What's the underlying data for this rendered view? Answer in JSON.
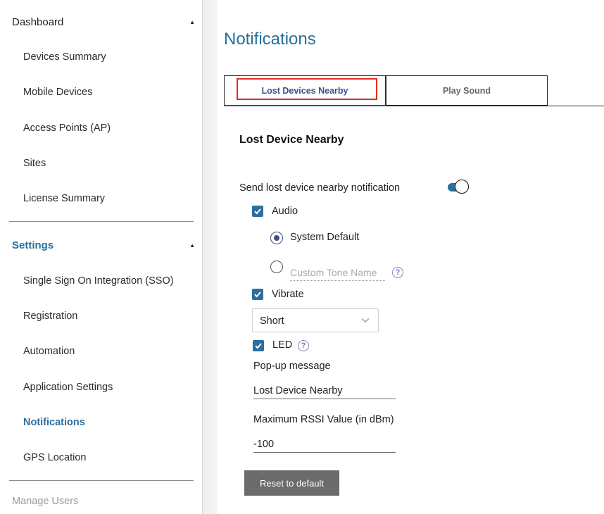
{
  "sidebar": {
    "dashboard": {
      "label": "Dashboard",
      "items": [
        "Devices Summary",
        "Mobile Devices",
        "Access Points (AP)",
        "Sites",
        "License Summary"
      ]
    },
    "settings": {
      "label": "Settings",
      "items": [
        "Single Sign On Integration (SSO)",
        "Registration",
        "Automation",
        "Application Settings",
        "Notifications",
        "GPS Location"
      ],
      "active_item": "Notifications"
    },
    "manage_users": "Manage Users"
  },
  "page": {
    "title": "Notifications"
  },
  "tabs": [
    {
      "label": "Lost Devices Nearby",
      "active": true
    },
    {
      "label": "Play Sound",
      "active": false
    }
  ],
  "form": {
    "section_title": "Lost Device Nearby",
    "send_notification": {
      "label": "Send lost device nearby notification",
      "on": true
    },
    "audio": {
      "label": "Audio",
      "checked": true,
      "options": [
        "System Default"
      ],
      "selected": "System Default",
      "custom_tone_placeholder": "Custom Tone Name"
    },
    "vibrate": {
      "label": "Vibrate",
      "checked": true,
      "selected": "Short"
    },
    "led": {
      "label": "LED",
      "checked": true
    },
    "popup": {
      "label": "Pop-up message",
      "value": "Lost Device Nearby"
    },
    "rssi": {
      "label": "Maximum RSSI Value (in dBm)",
      "value": "-100"
    },
    "reset_label": "Reset to default"
  },
  "colors": {
    "accent": "#2a6f9e",
    "active_tab": "#3b4f8a",
    "highlight": "#e02b20",
    "button": "#6b6b6b",
    "help_icon": "#7a86c8"
  }
}
